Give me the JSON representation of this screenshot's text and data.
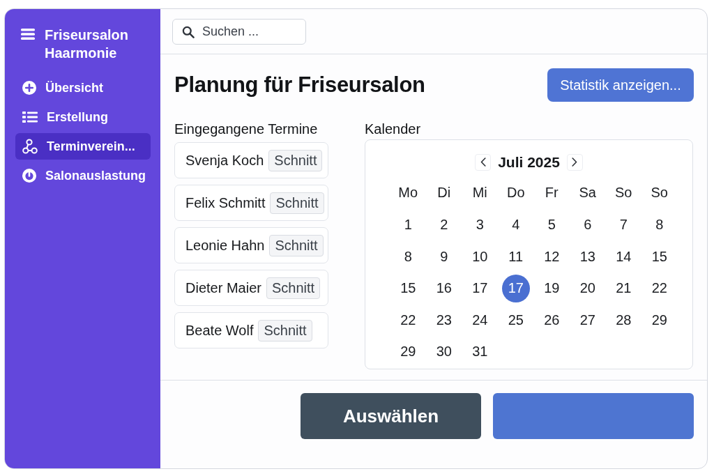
{
  "sidebar": {
    "title": "Friseursalon Haarmonie",
    "items": [
      {
        "label": "Übersicht",
        "selected": false
      },
      {
        "label": "Erstellung",
        "selected": false
      },
      {
        "label": "Terminverein...",
        "selected": true
      },
      {
        "label": "Salonauslastung",
        "selected": false
      }
    ]
  },
  "search": {
    "placeholder": "Suchen ..."
  },
  "page": {
    "title": "Planung für Friseursalon",
    "action": "Statistik anzeigen..."
  },
  "appointments": {
    "heading": "Eingegangene Termine",
    "items": [
      {
        "name": "Svenja Koch",
        "tag": "Schnitt"
      },
      {
        "name": "Felix Schmitt",
        "tag": "Schnitt"
      },
      {
        "name": "Leonie Hahn",
        "tag": "Schnitt"
      },
      {
        "name": "Dieter Maier",
        "tag": "Schnitt"
      },
      {
        "name": "Beate Wolf",
        "tag": "Schnitt"
      }
    ]
  },
  "calendar": {
    "heading": "Kalender",
    "month": "Juli 2025",
    "weekdays": [
      "Mo",
      "Di",
      "Mi",
      "Do",
      "Fr",
      "Sa",
      "So",
      "So"
    ],
    "weeks": [
      [
        {
          "label": "1",
          "selected": false
        },
        {
          "label": "2",
          "selected": false
        },
        {
          "label": "3",
          "selected": false
        },
        {
          "label": "4",
          "selected": false
        },
        {
          "label": "5",
          "selected": false
        },
        {
          "label": "6",
          "selected": false
        },
        {
          "label": "7",
          "selected": false
        },
        {
          "label": "8",
          "selected": false
        }
      ],
      [
        {
          "label": "8",
          "selected": false
        },
        {
          "label": "9",
          "selected": false
        },
        {
          "label": "10",
          "selected": false
        },
        {
          "label": "11",
          "selected": false
        },
        {
          "label": "12",
          "selected": false
        },
        {
          "label": "13",
          "selected": false
        },
        {
          "label": "14",
          "selected": false
        },
        {
          "label": "15",
          "selected": false
        }
      ],
      [
        {
          "label": "15",
          "selected": false
        },
        {
          "label": "16",
          "selected": false
        },
        {
          "label": "17",
          "selected": false
        },
        {
          "label": "17",
          "selected": true
        },
        {
          "label": "19",
          "selected": false
        },
        {
          "label": "20",
          "selected": false
        },
        {
          "label": "21",
          "selected": false
        },
        {
          "label": "22",
          "selected": false
        }
      ],
      [
        {
          "label": "22",
          "selected": false
        },
        {
          "label": "23",
          "selected": false
        },
        {
          "label": "24",
          "selected": false
        },
        {
          "label": "25",
          "selected": false
        },
        {
          "label": "26",
          "selected": false
        },
        {
          "label": "27",
          "selected": false
        },
        {
          "label": "28",
          "selected": false
        },
        {
          "label": "29",
          "selected": false
        }
      ],
      [
        {
          "label": "29",
          "selected": false
        },
        {
          "label": "30",
          "selected": false
        },
        {
          "label": "31",
          "selected": false
        }
      ]
    ]
  },
  "footer_buttons": [
    {
      "label": "Auswählen",
      "kind": "secondary"
    },
    {
      "kind": "primary"
    }
  ]
}
